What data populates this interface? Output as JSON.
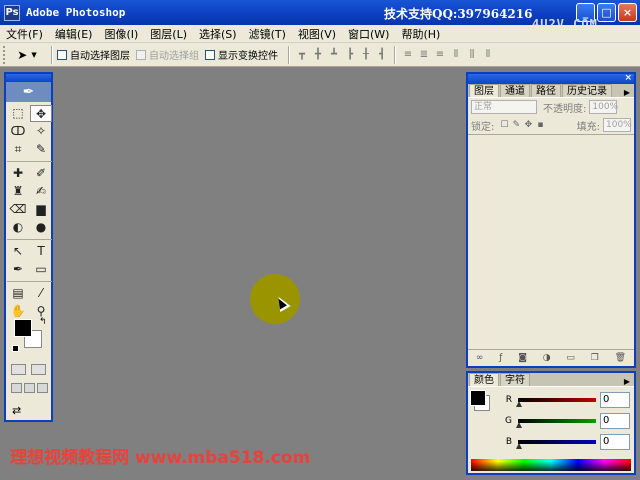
{
  "window": {
    "title": "Adobe Photoshop",
    "app_icon_letter": "Ps",
    "support_text": "技术支持QQ:397964216",
    "watermark_logo": "4U2V.COM",
    "buttons": {
      "minimize": "_",
      "maximize": "□",
      "close": "×"
    }
  },
  "menubar": {
    "items": [
      {
        "label": "文件(F)"
      },
      {
        "label": "编辑(E)"
      },
      {
        "label": "图像(I)"
      },
      {
        "label": "图层(L)"
      },
      {
        "label": "选择(S)"
      },
      {
        "label": "滤镜(T)"
      },
      {
        "label": "视图(V)"
      },
      {
        "label": "窗口(W)"
      },
      {
        "label": "帮助(H)"
      }
    ]
  },
  "options_bar": {
    "tool_preset_glyph": "➤",
    "auto_select_layer": "自动选择图层",
    "auto_select_group": "自动选择组",
    "show_transform_controls": "显示变换控件"
  },
  "toolbox": {
    "feather_glyph": "✒",
    "tools": [
      {
        "name": "marquee-tool-icon",
        "glyph": "⬚"
      },
      {
        "name": "move-tool-icon",
        "glyph": "✥",
        "active": true
      },
      {
        "name": "lasso-tool-icon",
        "glyph": "ↀ"
      },
      {
        "name": "magic-wand-tool-icon",
        "glyph": "✧"
      },
      {
        "name": "crop-tool-icon",
        "glyph": "⌗"
      },
      {
        "name": "slice-tool-icon",
        "glyph": "✎"
      },
      {
        "name": "healing-brush-tool-icon",
        "glyph": "✚"
      },
      {
        "name": "brush-tool-icon",
        "glyph": "✐"
      },
      {
        "name": "clone-stamp-tool-icon",
        "glyph": "♜"
      },
      {
        "name": "history-brush-tool-icon",
        "glyph": "✍"
      },
      {
        "name": "eraser-tool-icon",
        "glyph": "⌫"
      },
      {
        "name": "gradient-tool-icon",
        "glyph": "▆"
      },
      {
        "name": "blur-tool-icon",
        "glyph": "◐"
      },
      {
        "name": "dodge-tool-icon",
        "glyph": "●"
      },
      {
        "name": "path-selection-tool-icon",
        "glyph": "↖"
      },
      {
        "name": "type-tool-icon",
        "glyph": "T"
      },
      {
        "name": "pen-tool-icon",
        "glyph": "✒"
      },
      {
        "name": "shape-tool-icon",
        "glyph": "▭"
      },
      {
        "name": "notes-tool-icon",
        "glyph": "▤"
      },
      {
        "name": "eyedropper-tool-icon",
        "glyph": "⁄"
      },
      {
        "name": "hand-tool-icon",
        "glyph": "✋"
      },
      {
        "name": "zoom-tool-icon",
        "glyph": "⚲"
      }
    ],
    "swap_glyph": "↰",
    "jump_glyph": "⇄"
  },
  "layers_palette": {
    "tabs": [
      {
        "label": "图层",
        "active": true
      },
      {
        "label": "通道"
      },
      {
        "label": "路径"
      },
      {
        "label": "历史记录"
      }
    ],
    "blend_mode": "正常",
    "opacity_label": "不透明度:",
    "opacity_value": "100%",
    "lock_label": "锁定:",
    "fill_label": "填充:",
    "fill_value": "100%"
  },
  "color_palette": {
    "tabs": [
      {
        "label": "颜色",
        "active": true
      },
      {
        "label": "字符"
      }
    ],
    "channels": [
      {
        "label": "R",
        "value": "0",
        "color": "#c00000"
      },
      {
        "label": "G",
        "value": "0",
        "color": "#00a000"
      },
      {
        "label": "B",
        "value": "0",
        "color": "#0000c0"
      }
    ]
  },
  "site_watermark": "理想视频教程网 www.mba518.com"
}
